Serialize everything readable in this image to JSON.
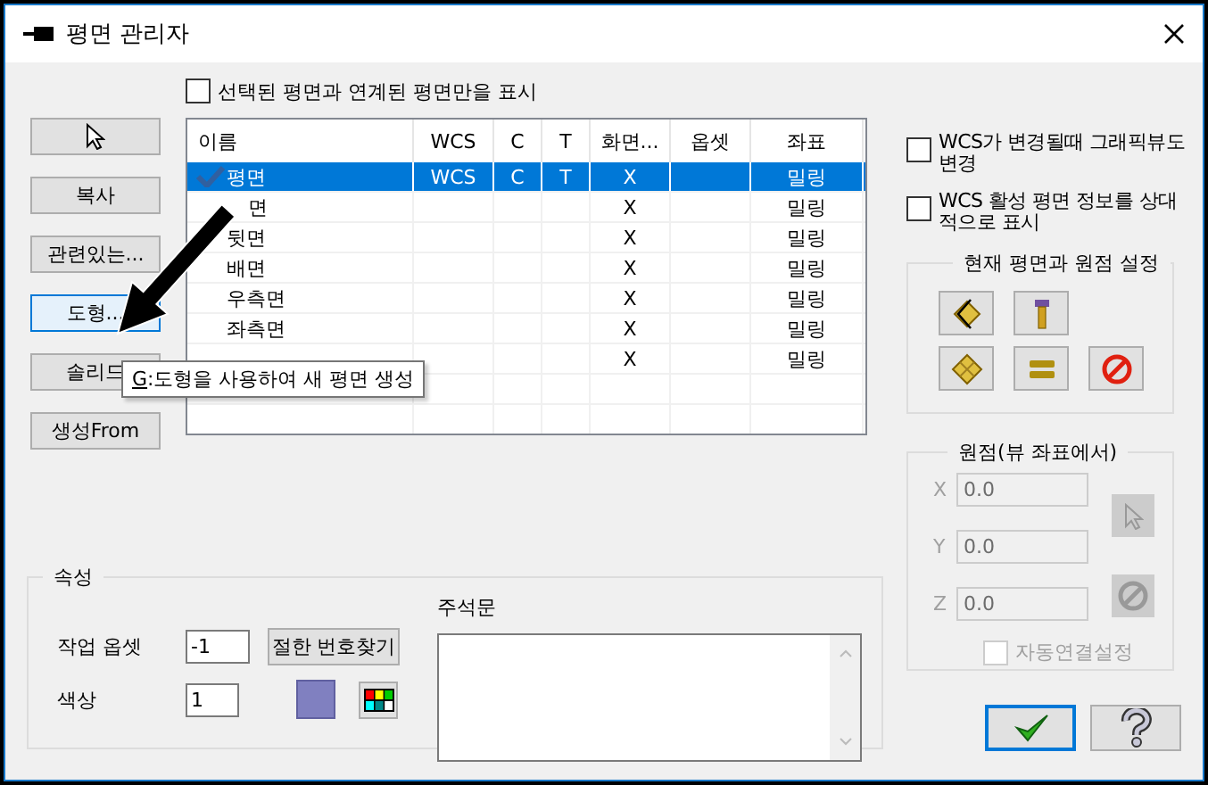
{
  "window": {
    "title": "평면 관리자"
  },
  "filter_checkbox": {
    "label": "선택된 평면과 연계된 평면만을 표시",
    "checked": false
  },
  "side_buttons": [
    {
      "kind": "pointer",
      "hot": false
    },
    {
      "kind": "text",
      "label": "복사",
      "hot": false
    },
    {
      "kind": "text",
      "label": "관련있는...",
      "hot": false
    },
    {
      "kind": "text",
      "label": "도형...",
      "hot": true
    },
    {
      "kind": "text",
      "label": "솔리드",
      "hot": false
    },
    {
      "kind": "text",
      "label": "생성From",
      "hot": false
    }
  ],
  "table": {
    "columns": [
      "이름",
      "WCS",
      "C",
      "T",
      "화면...",
      "옵셋",
      "좌표"
    ],
    "rows": [
      {
        "name": "평면",
        "wcs": "WCS",
        "c": "C",
        "t": "T",
        "screen": "X",
        "coord": "밀링",
        "selected": true,
        "checked": true
      },
      {
        "name": "면",
        "covered": true,
        "screen": "X",
        "coord": "밀링",
        "selected": false,
        "checked": false
      },
      {
        "name": "뒷면",
        "screen": "X",
        "coord": "밀링",
        "selected": false,
        "checked": false
      },
      {
        "name": "배면",
        "screen": "X",
        "coord": "밀링",
        "selected": false,
        "checked": false
      },
      {
        "name": "우측면",
        "screen": "X",
        "coord": "밀링",
        "selected": false,
        "checked": false
      },
      {
        "name": "좌측면",
        "screen": "X",
        "coord": "밀링",
        "selected": false,
        "checked": false
      },
      {
        "screen": "X",
        "coord": "밀링",
        "selected": false,
        "checked": false
      }
    ]
  },
  "tooltip": {
    "hotkey": "G",
    "text": ":도형을 사용하여 새 평면 생성"
  },
  "options": [
    {
      "label": "WCS가 변경될때 그래픽뷰도 변경",
      "checked": false
    },
    {
      "label": "WCS 활성 평면 정보를 상대적으로 표시",
      "checked": false
    }
  ],
  "plane_group": {
    "title": "현재 평면과 원점 설정"
  },
  "origin_group": {
    "title": "원점(뷰 좌표에서)",
    "fields": [
      {
        "axis": "X",
        "value": "0.0"
      },
      {
        "axis": "Y",
        "value": "0.0"
      },
      {
        "axis": "Z",
        "value": "0.0"
      }
    ],
    "disabled": true,
    "auto_link": {
      "label": "자동연결설정",
      "checked": false
    }
  },
  "properties": {
    "title": "속성",
    "offset_label": "작업 옵셋",
    "offset_value": "-1",
    "find_button": "절한 번호찾기",
    "color_label": "색상",
    "color_value": "1",
    "color": "#8080c0",
    "notes_label": "주석문"
  }
}
